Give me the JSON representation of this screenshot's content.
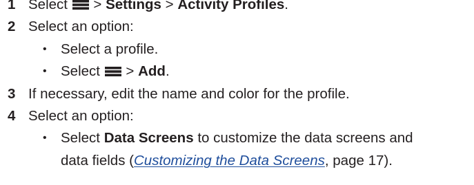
{
  "steps": [
    {
      "number": "1",
      "select": "Select",
      "icon": "menu-icon",
      "sep1": ">",
      "settings": "Settings",
      "sep2": ">",
      "activity_profiles": "Activity Profiles",
      "end": "."
    },
    {
      "number": "2",
      "text": "Select an option:",
      "bullets": [
        {
          "glyph": "•",
          "text": "Select a profile."
        },
        {
          "glyph": "•",
          "select": "Select",
          "icon": "menu-icon",
          "sep": ">",
          "add": "Add",
          "end": "."
        }
      ]
    },
    {
      "number": "3",
      "text": "If necessary, edit the name and color for the profile."
    },
    {
      "number": "4",
      "text": "Select an option:",
      "bullets": [
        {
          "glyph": "•",
          "select": "Select",
          "bold": "Data Screens",
          "rest": "to customize the data screens and",
          "line2_start": "data fields (",
          "link": "Customizing the Data Screens",
          "line2_mid": ", page 17",
          "line2_end": ")."
        }
      ]
    }
  ]
}
